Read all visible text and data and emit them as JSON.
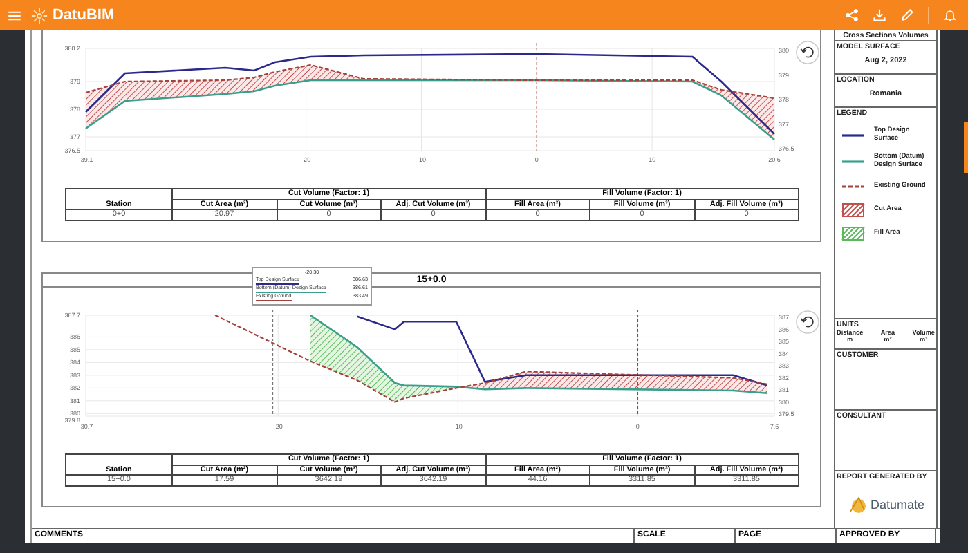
{
  "app": {
    "name": "DatuBIM"
  },
  "sections": [
    {
      "chart_data": {
        "type": "line",
        "grid": true,
        "x": [
          -39.1,
          -35.7,
          -27,
          -24.5,
          -22.7,
          -19.6,
          -15,
          0,
          13.5,
          16,
          20.6
        ],
        "xlim": [
          -39.1,
          20.6
        ],
        "ylim": [
          376.5,
          380.2
        ],
        "xticks": [
          -39.1,
          -20,
          -10,
          0,
          10,
          20.6
        ],
        "yticks": [
          376.5,
          377,
          378,
          379,
          380.2
        ],
        "series": [
          {
            "color": "#2b2a8c",
            "line_style": "solid",
            "values": [
              377.9,
              379.3,
              379.5,
              379.4,
              379.7,
              379.9,
              379.95,
              380,
              379.9,
              379.0,
              377.1
            ]
          },
          {
            "color": "#3a9e8c",
            "line_style": "solid",
            "values": [
              377.3,
              378.3,
              378.55,
              378.65,
              378.85,
              379.05,
              379.05,
              379.05,
              379.0,
              378.5,
              376.9
            ]
          },
          {
            "color": "#a6403a",
            "line_style": "dashed",
            "values": [
              378.6,
              379.0,
              379.05,
              379.15,
              379.35,
              379.6,
              379.1,
              379.05,
              379.05,
              378.7,
              378.4
            ]
          }
        ],
        "ref_lines": [
          {
            "axis": "x",
            "value": 0,
            "color": "#a6403a"
          }
        ]
      },
      "right_axis_labels": [
        "380",
        "379",
        "378",
        "377",
        "376.5"
      ],
      "table": {
        "groups": [
          "Cut Volume (Factor: 1)",
          "Fill Volume (Factor: 1)"
        ],
        "columns": [
          "Station",
          "Cut Area (m²)",
          "Cut Volume (m³)",
          "Adj. Cut Volume (m³)",
          "Fill Area (m²)",
          "Fill Volume (m³)",
          "Adj. Fill Volume (m³)"
        ],
        "rows": [
          [
            "0+0",
            "20.97",
            "0",
            "0",
            "0",
            "0",
            "0"
          ]
        ]
      }
    },
    {
      "title": "15+0.0",
      "chart_data": {
        "type": "line",
        "grid": true,
        "x": [
          -23.5,
          -18.2,
          -15.6,
          -13.5,
          -13,
          -10.1,
          -8.5,
          -6.2,
          5.3,
          7.2
        ],
        "xlim": [
          -30.7,
          7.6
        ],
        "ylim": [
          379.8,
          387.7
        ],
        "xticks": [
          -30.7,
          -20,
          -10,
          0,
          7.6
        ],
        "yticks": [
          379.8,
          380,
          381,
          382,
          383,
          384,
          385,
          386,
          387.7
        ],
        "series": [
          {
            "color": "#2b2a8c",
            "line_style": "solid",
            "values": [
              null,
              null,
              387.6,
              386.6,
              387.2,
              387.2,
              382.5,
              383,
              383,
              382.2
            ]
          },
          {
            "color": "#3a9e8c",
            "line_style": "solid",
            "values": [
              null,
              387.7,
              385.2,
              382.4,
              382.2,
              382.1,
              381.9,
              382,
              381.8,
              381.6
            ]
          },
          {
            "color": "#a6403a",
            "line_style": "dashed",
            "values": [
              387.7,
              384.1,
              382.6,
              380.9,
              381.2,
              382,
              382.4,
              383.3,
              382.8,
              382.3
            ]
          }
        ],
        "ref_lines": [
          {
            "axis": "x",
            "value": 0,
            "color": "#a6403a"
          },
          {
            "axis": "x",
            "value": -20.3,
            "color": "#777777"
          }
        ]
      },
      "right_axis_labels": [
        "387",
        "386",
        "385",
        "384",
        "383",
        "382",
        "381",
        "380",
        "379.5"
      ],
      "tooltip": {
        "title": "-20.30",
        "rows": [
          {
            "label": "Top Design Surface",
            "value": "386.63",
            "color": "#2b2a8c"
          },
          {
            "label": "Bottom (Datum) Design Surface",
            "value": "386.61",
            "color": "#3a9e8c"
          },
          {
            "label": "Existing Ground",
            "value": "383.49",
            "color": "#a6403a"
          }
        ]
      },
      "table": {
        "groups": [
          "Cut Volume (Factor: 1)",
          "Fill Volume (Factor: 1)"
        ],
        "columns": [
          "Station",
          "Cut Area (m²)",
          "Cut Volume (m³)",
          "Adj. Cut Volume (m³)",
          "Fill Area (m²)",
          "Fill Volume (m³)",
          "Adj. Fill Volume (m³)"
        ],
        "rows": [
          [
            "15+0.0",
            "17.59",
            "3642.19",
            "3642.19",
            "44.16",
            "3311.85",
            "3311.85"
          ]
        ]
      }
    }
  ],
  "panel": {
    "title": "Cross Sections Volumes",
    "model_surface": {
      "label": "MODEL SURFACE",
      "value": "Aug 2, 2022"
    },
    "location": {
      "label": "LOCATION",
      "value": "Romania"
    },
    "legend": {
      "label": "LEGEND",
      "items": [
        {
          "label": "Top Design Surface",
          "kind": "line",
          "color": "#2b2a8c"
        },
        {
          "label": "Bottom (Datum) Design Surface",
          "kind": "line",
          "color": "#3a9e8c"
        },
        {
          "label": "Existing Ground",
          "kind": "dashed",
          "color": "#a6403a"
        },
        {
          "label": "Cut Area",
          "kind": "hatch",
          "color": "#c0504d"
        },
        {
          "label": "Fill Area",
          "kind": "hatch",
          "color": "#5cb85c"
        }
      ]
    },
    "units": {
      "label": "UNITS",
      "columns": [
        {
          "name": "Distance",
          "unit": "m"
        },
        {
          "name": "Area",
          "unit": "m²"
        },
        {
          "name": "Volume",
          "unit": "m³"
        }
      ]
    },
    "customer": "CUSTOMER",
    "consultant": "CONSULTANT",
    "report_generated_by": "REPORT GENERATED BY",
    "logo_text": "Datumate"
  },
  "footer": {
    "comments": "COMMENTS",
    "scale": "SCALE",
    "page": "PAGE",
    "approved_by": "APPROVED BY"
  }
}
